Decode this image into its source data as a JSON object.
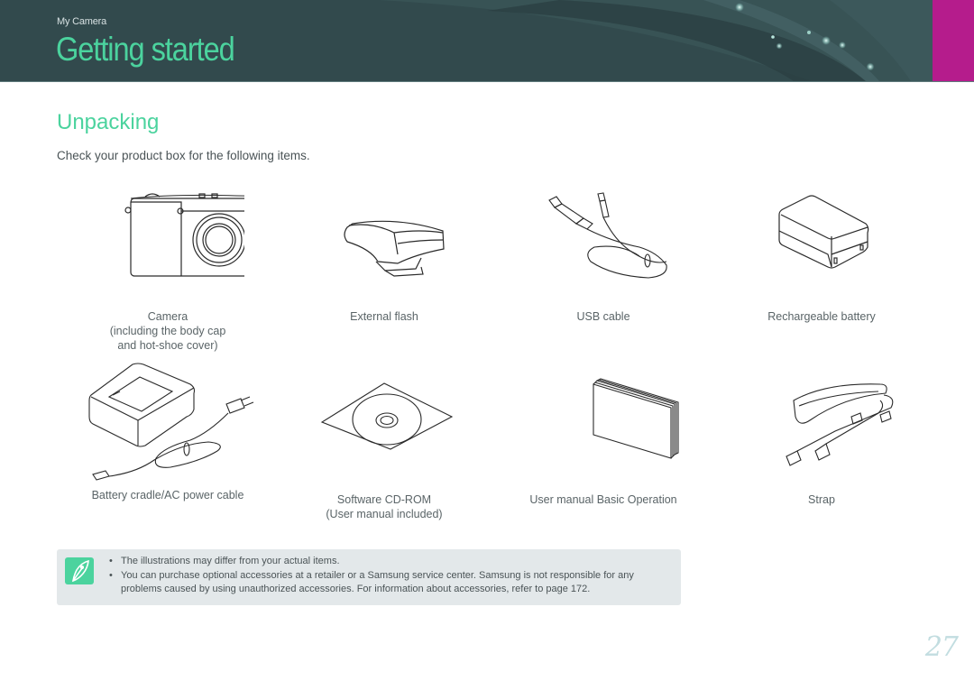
{
  "header": {
    "section": "My Camera",
    "title": "Getting started",
    "tab_color": "#b51c8c",
    "background_color": "#324a4d",
    "accent_color": "#4bd39e"
  },
  "content": {
    "heading": "Unpacking",
    "intro": "Check your product box for the following items.",
    "items": [
      {
        "icon": "camera-icon",
        "label": "Camera\n(including the body cap\nand hot-shoe cover)"
      },
      {
        "icon": "external-flash-icon",
        "label": "External flash"
      },
      {
        "icon": "usb-cable-icon",
        "label": "USB cable"
      },
      {
        "icon": "battery-icon",
        "label": "Rechargeable battery"
      },
      {
        "icon": "battery-charger-icon",
        "label": "Battery cradle/AC power cable"
      },
      {
        "icon": "cd-rom-icon",
        "label": "Software CD-ROM\n(User manual included)"
      },
      {
        "icon": "user-manual-icon",
        "label": "User manual Basic Operation"
      },
      {
        "icon": "strap-icon",
        "label": "Strap"
      }
    ]
  },
  "note": {
    "icon": "pen-note-icon",
    "bullets": [
      "The illustrations may differ from your actual items.",
      "You can purchase optional accessories at a retailer or a Samsung service center. Samsung is not responsible for any problems caused by using unauthorized accessories. For information about accessories, refer to page 172."
    ]
  },
  "footer": {
    "page_number": "27"
  }
}
